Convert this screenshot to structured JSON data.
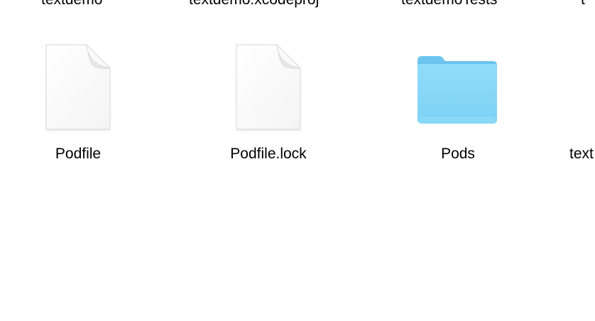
{
  "top_row": {
    "labels": [
      "textdemo",
      "textdemo.xcodeproj",
      "textdemoTests",
      "t"
    ]
  },
  "items": [
    {
      "name": "Podfile",
      "icon": "document-icon"
    },
    {
      "name": "Podfile.lock",
      "icon": "document-icon"
    },
    {
      "name": "Pods",
      "icon": "folder-icon"
    },
    {
      "name": "text",
      "icon": "document-icon"
    }
  ],
  "colors": {
    "folder_light": "#8fdcf9",
    "folder_dark": "#6dc6ef",
    "document_fill": "#fdfdfd",
    "document_edge": "#d9d9d9"
  }
}
